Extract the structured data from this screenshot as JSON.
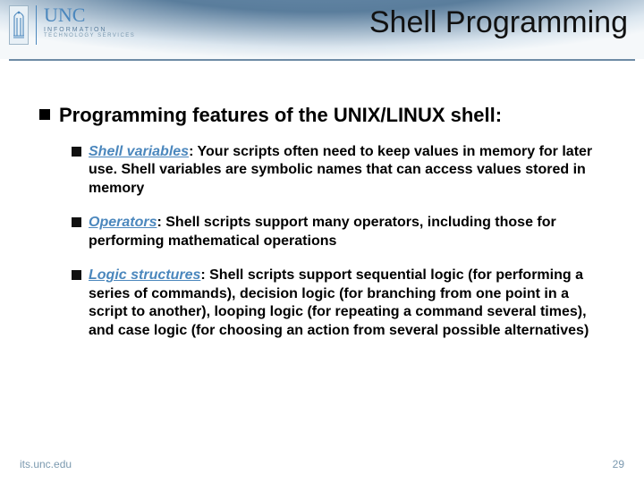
{
  "brand": {
    "name": "UNC",
    "sub1": "INFORMATION",
    "sub2": "TECHNOLOGY SERVICES"
  },
  "title": "Shell Programming",
  "heading": "Programming features of the UNIX/LINUX shell:",
  "items": [
    {
      "term": "Shell variables",
      "text": ":  Your scripts often need to keep values in memory for later use.  Shell variables are symbolic names that can access values stored in memory"
    },
    {
      "term": "Operators",
      "text": ":  Shell scripts support many operators, including those for performing mathematical operations"
    },
    {
      "term": "Logic structures",
      "text_parts": [
        ":  Shell scripts support ",
        {
          "em": "sequential logic"
        },
        " (for performing a series of commands), ",
        {
          "em": "decision logic"
        },
        " (for branching from one point in a script to another), ",
        {
          "em": "looping logic"
        },
        " (for repeating a command several times), and ",
        {
          "em": "case logic"
        },
        " (for choosing an action from several possible alternatives)"
      ]
    }
  ],
  "footer": {
    "left": "its.unc.edu",
    "right": "29"
  }
}
